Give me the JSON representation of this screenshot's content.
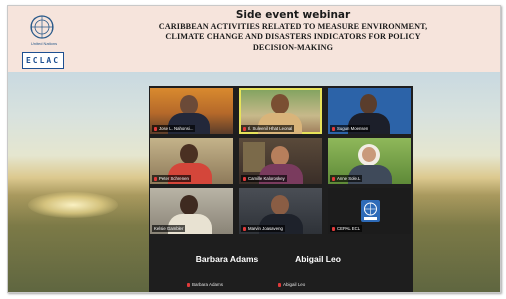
{
  "header": {
    "title_line1": "Side event webinar",
    "title_line2": "CARIBBEAN ACTIVITIES RELATED TO MEASURE ENVIRONMENT,",
    "title_line3": "CLIMATE CHANGE AND DISASTERS INDICATORS FOR POLICY",
    "title_line4": "DECISION-MAKING",
    "org_caption": "United Nations",
    "eclac_label": "ECLAC"
  },
  "participants": [
    {
      "name": "Jose L. Nahonsi...",
      "muted": true
    },
    {
      "name": "Il. Suleenil Hhat Leonal",
      "muted": true
    },
    {
      "name": "Sugun Moensen",
      "muted": true
    },
    {
      "name": "Peter Schrenen",
      "muted": true
    },
    {
      "name": "Camille Kaloroskey",
      "muted": true
    },
    {
      "name": "Anne Sole.L",
      "muted": true
    },
    {
      "name": "Kelsie Gambler",
      "muted": false
    },
    {
      "name": "Marvin Joasaveng",
      "muted": true
    },
    {
      "name": "CEPAL ECL",
      "muted": true
    }
  ],
  "audio_only": [
    {
      "display": "Barbara Adams",
      "tag": "Barbara Adams"
    },
    {
      "display": "Abigail Leo",
      "tag": "Abigail Leo"
    }
  ],
  "colors": {
    "header_bg": "#f6e4dc",
    "zoom_bg": "#1e1e1e",
    "active_speaker": "#e7e35a",
    "un_blue": "#2e6bb8"
  }
}
